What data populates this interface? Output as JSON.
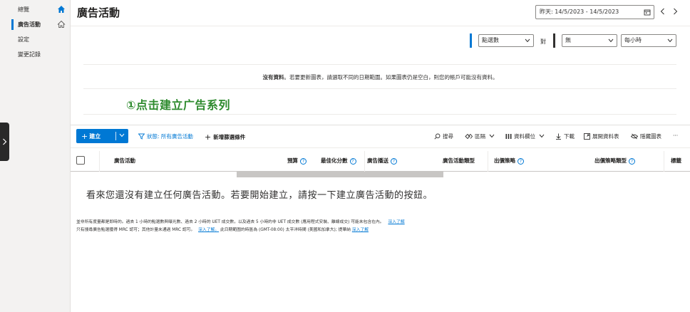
{
  "sidebar": {
    "items": [
      {
        "label": "總覽",
        "icon": "home-icon",
        "active": false
      },
      {
        "label": "廣告活動",
        "icon": "home-outline-icon",
        "active": true
      },
      {
        "label": "設定",
        "active": false
      },
      {
        "label": "變更記錄",
        "active": false
      }
    ]
  },
  "header": {
    "title": "廣告活動",
    "date_range": "昨天: 14/5/2023 - 14/5/2023"
  },
  "chart": {
    "metric1": "點選數",
    "versus": "對",
    "metric2": "無",
    "granularity": "每小時",
    "no_data_bold": "沒有資料",
    "no_data_rest": "。若要更新圖表，請選取不同的日期範圍。如果圖表仍是空白，則您的帳戶可能沒有資料。",
    "metric1_color": "#0078d4",
    "metric2_color": "#323130"
  },
  "annotation": "①点击建立广告系列",
  "toolbar": {
    "create": "建立",
    "filter_status": "狀態: 所有廣告活動",
    "add_filter": "新增篩選條件",
    "search": "搜尋",
    "segment": "區隔",
    "columns": "資料欄位",
    "download": "下載",
    "expand": "展開資料表",
    "hide_chart": "隱藏圖表",
    "more": "···"
  },
  "table": {
    "headers": {
      "campaign": "廣告活動",
      "budget": "預算",
      "opt_score": "最佳化分數",
      "delivery": "廣告播送",
      "type": "廣告活動類型",
      "bid_strategy": "出價策略",
      "bid_strategy_type": "出價策略類型",
      "labels": "標籤"
    },
    "empty_message": "看來您還沒有建立任何廣告活動。若要開始建立，請按一下建立廣告活動的按鈕。"
  },
  "footnotes": {
    "line1": "並非所有度量都是即時的。過去 1 小時的點選數與曝光數、過去 2 小時的 UET 成交數，以及過去 5 小時的非 UET 成交數 (應用程式安裝、離線成交) 可能未包含在內。",
    "line1_link": "深入了解",
    "line2_a": "只有搜尋廣告點選獲得 MRC 認可；其他計量未通過 MRC 認可。",
    "line2_link1": "深入了解。",
    "line2_b": " 此日期範圍的時區為 (GMT-08:00) 太平洋時間 (美國和加拿大); 提華納 ",
    "line2_link2": "深入了解"
  }
}
